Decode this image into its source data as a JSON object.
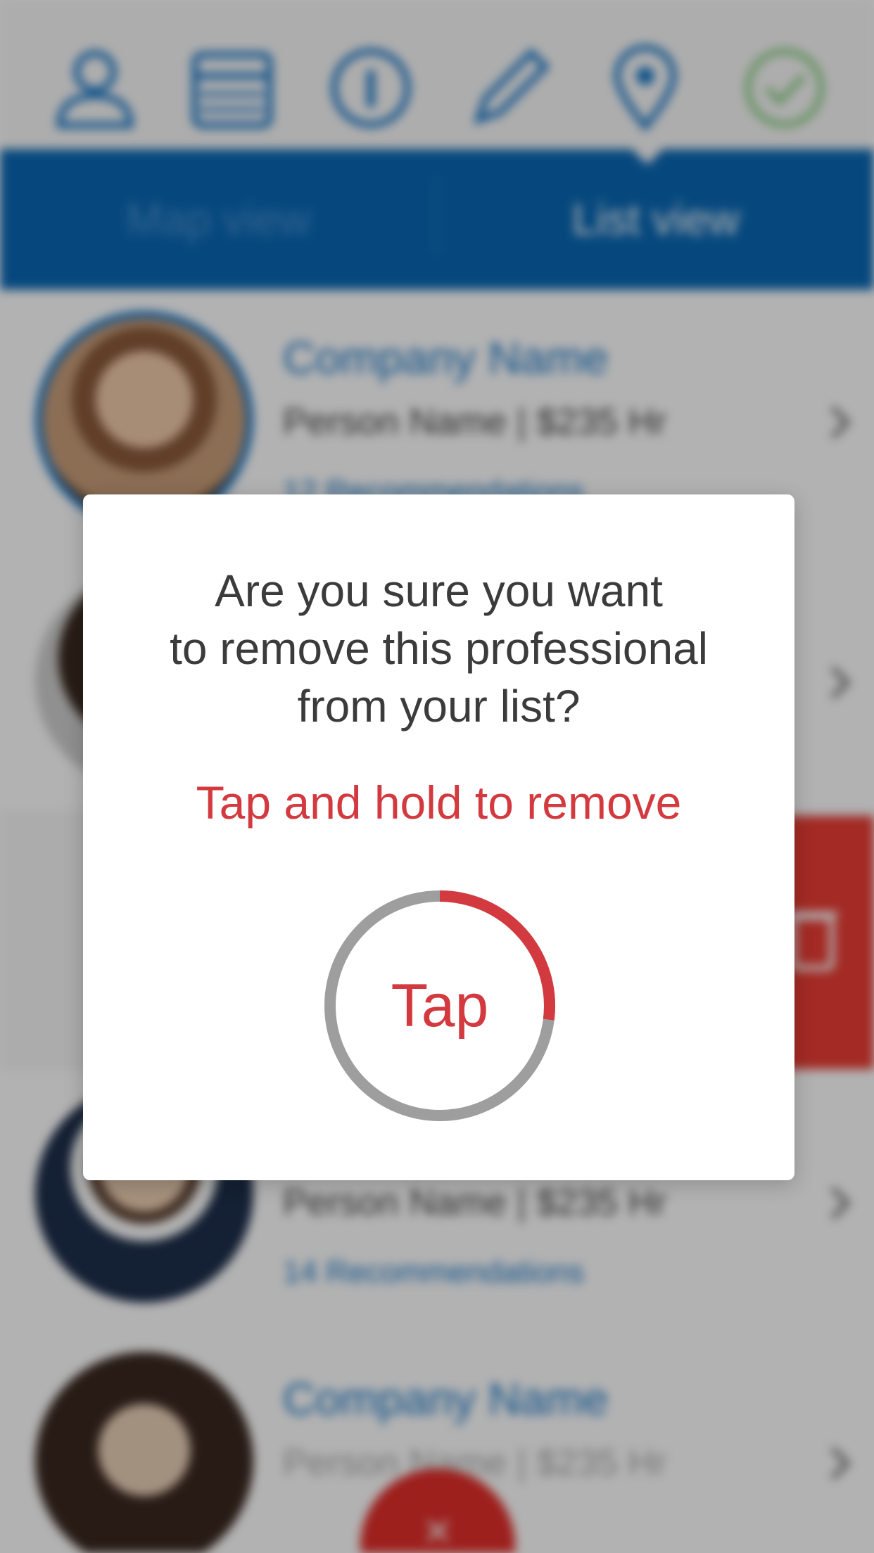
{
  "nav": {
    "icons": [
      "profile-icon",
      "calendar-icon",
      "info-icon",
      "pencil-icon",
      "location-pin-icon",
      "checkmark-icon"
    ]
  },
  "segment": {
    "map_label": "Map view",
    "list_label": "List view",
    "selected": "List view"
  },
  "list": {
    "rows": [
      {
        "company": "Company Name",
        "person": "Person Name",
        "rate": "$235 Hr",
        "recommendations": "12 Recommendations"
      },
      {
        "company": "",
        "person": "",
        "rate": "",
        "recommendations": ""
      },
      {
        "company": "",
        "person": "Person Name",
        "rate": "$235 Hr",
        "recommendations": "14 Recommendations"
      },
      {
        "company": "Company Name",
        "person": "Person Name",
        "rate": "$235 Hr",
        "recommendations": ""
      }
    ]
  },
  "modal": {
    "question_lines": [
      "Are you sure you want",
      "to remove this professional",
      "from your list?"
    ],
    "hint": "Tap and hold to remove",
    "ring_label": "Tap",
    "progress": 0.27,
    "colors": {
      "accent": "#d33a3f",
      "track": "#9e9e9e"
    }
  },
  "fab": {
    "label": "×"
  },
  "colors": {
    "primary_blue": "#0a68b4",
    "danger_red": "#ea3d35"
  }
}
